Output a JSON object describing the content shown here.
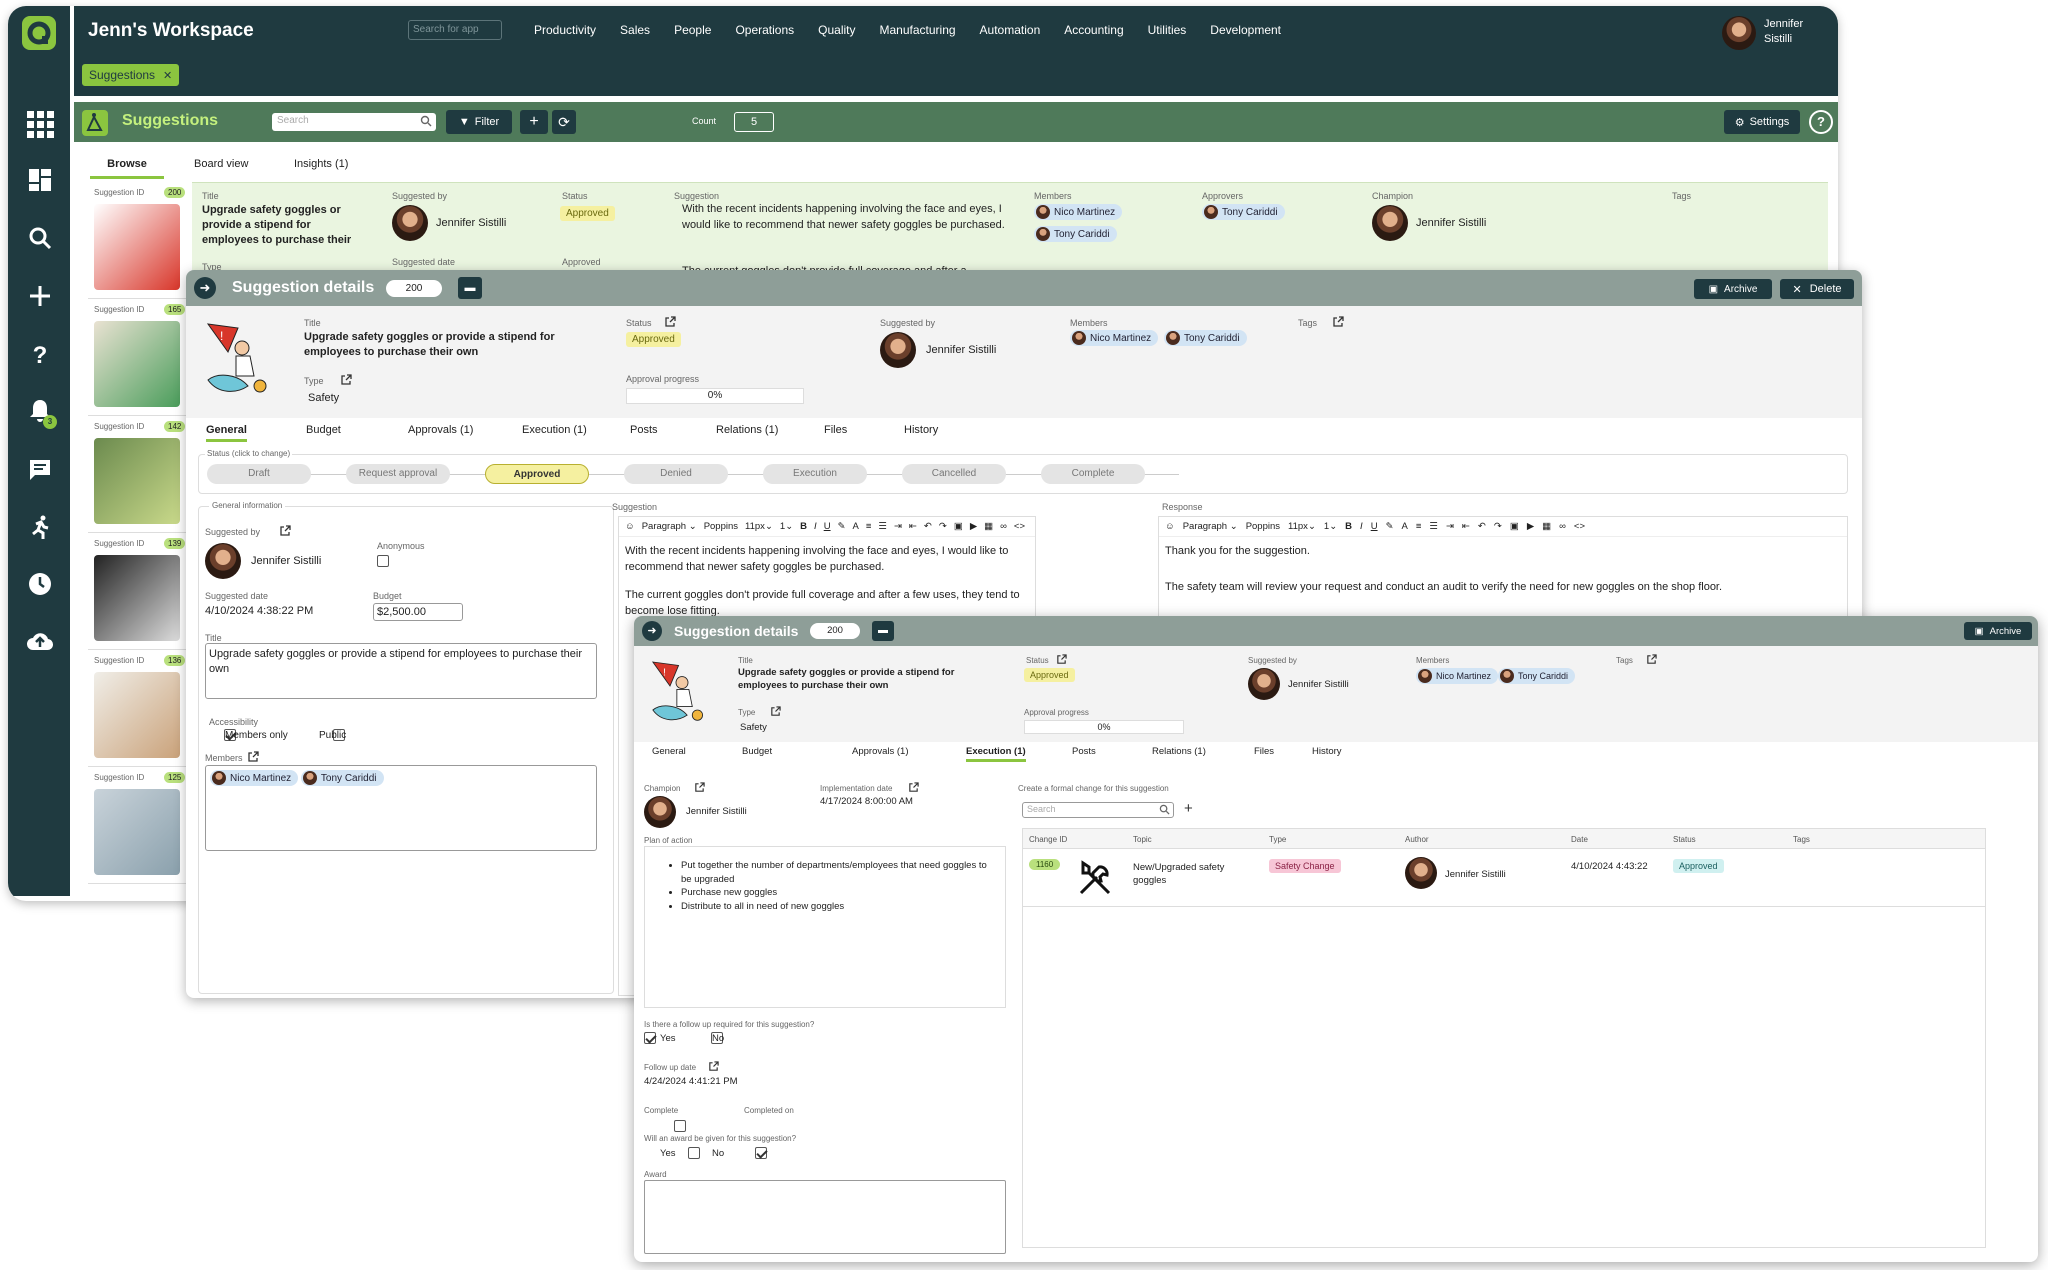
{
  "app": {
    "title": "Jenn's Workspace",
    "search_placeholder": "Search for app",
    "user_name": "Jennifer Sistilli",
    "user_name_l1": "Jennifer",
    "user_name_l2": "Sistilli",
    "notif_count": "3"
  },
  "nav": [
    "Productivity",
    "Sales",
    "People",
    "Operations",
    "Quality",
    "Manufacturing",
    "Automation",
    "Accounting",
    "Utilities",
    "Development"
  ],
  "tab_chip": "Suggestions",
  "toolbar": {
    "title": "Suggestions",
    "search_placeholder": "Search",
    "filter": "Filter",
    "count_label": "Count",
    "count": "5",
    "settings": "Settings"
  },
  "tabs": [
    "Browse",
    "Board view",
    "Insights (1)"
  ],
  "list": [
    {
      "id": "200"
    },
    {
      "id": "165"
    },
    {
      "id": "142"
    },
    {
      "id": "139"
    },
    {
      "id": "136"
    },
    {
      "id": "125"
    }
  ],
  "list_label": "Suggestion ID",
  "card": {
    "title_label": "Title",
    "title": "Upgrade safety goggles or provide a stipend for employees to purchase their",
    "type_label": "Type",
    "suggested_by_label": "Suggested by",
    "suggested_by": "Jennifer Sistilli",
    "suggested_date_label": "Suggested date",
    "status_label": "Status",
    "status": "Approved",
    "approved_label": "Approved",
    "suggestion_label": "Suggestion",
    "suggestion": "With the recent incidents happening involving the face and eyes, I would like to recommend that newer safety goggles be purchased.",
    "suggestion2": "The current goggles don't provide full coverage and after a",
    "members_label": "Members",
    "approvers_label": "Approvers",
    "approver": "Tony Cariddi",
    "champion_label": "Champion",
    "champion": "Jennifer Sistilli",
    "tags_label": "Tags",
    "members": [
      "Nico Martinez",
      "Tony Cariddi"
    ]
  },
  "details": {
    "header": "Suggestion details",
    "id": "200",
    "archive": "Archive",
    "delete": "Delete",
    "title_label": "Title",
    "title": "Upgrade safety goggles or provide a stipend for employees to purchase their own",
    "type_label": "Type",
    "type": "Safety",
    "status_label": "Status",
    "status": "Approved",
    "progress_label": "Approval progress",
    "progress": "0%",
    "suggested_by_label": "Suggested by",
    "suggested_by": "Jennifer Sistilli",
    "members_label": "Members",
    "members": [
      "Nico Martinez",
      "Tony Cariddi"
    ],
    "tags_label": "Tags",
    "tabs": [
      "General",
      "Budget",
      "Approvals (1)",
      "Execution (1)",
      "Posts",
      "Relations (1)",
      "Files",
      "History"
    ],
    "status_hint": "Status (click to change)",
    "steps": [
      "Draft",
      "Request approval",
      "Approved",
      "Denied",
      "Execution",
      "Cancelled",
      "Complete"
    ],
    "gen_info": "General information",
    "anonymous_label": "Anonymous",
    "suggested_date_label": "Suggested date",
    "suggested_date": "4/10/2024 4:38:22 PM",
    "budget_label": "Budget",
    "budget": "$2,500.00",
    "title_field": "Upgrade safety goggles or provide a stipend for employees to purchase their own",
    "accessibility_label": "Accessibility",
    "members_only": "Members only",
    "public": "Public",
    "suggestion_label": "Suggestion",
    "response_label": "Response",
    "editor": {
      "paragraph": "Paragraph",
      "font": "Poppins",
      "size": "11px",
      "lh": "1"
    },
    "suggestion_text": "With the recent incidents happening involving the face and eyes, I would like to recommend that newer safety goggles be purchased.",
    "suggestion_text2": "The current goggles don't provide full coverage and after a few uses, they tend to become lose fitting.",
    "response_text": "Thank you for the suggestion.",
    "response_text2": "The safety team will review your request and conduct an audit to verify the need for new goggles on the shop floor."
  },
  "exec": {
    "champion_label": "Champion",
    "champion": "Jennifer Sistilli",
    "impl_label": "Implementation date",
    "impl_date": "4/17/2024 8:00:00 AM",
    "plan_label": "Plan of action",
    "plan": [
      "Put together the number of departments/employees that need goggles to be upgraded",
      "Purchase new goggles",
      "Distribute to all in need of new goggles"
    ],
    "followup_q": "Is there a follow up required for this suggestion?",
    "yes": "Yes",
    "no": "No",
    "followup_date_label": "Follow up date",
    "followup_date": "4/24/2024 4:41:21 PM",
    "complete_label": "Complete",
    "completed_on_label": "Completed on",
    "award_q": "Will an award be given for this suggestion?",
    "award_label": "Award",
    "change_hint": "Create a formal change for this suggestion",
    "search_placeholder": "Search",
    "cols": [
      "Change ID",
      "Topic",
      "Type",
      "Author",
      "Date",
      "Status",
      "Tags"
    ],
    "row": {
      "id": "1160",
      "topic": "New/Upgraded safety goggles",
      "type": "Safety Change",
      "author": "Jennifer Sistilli",
      "date": "4/10/2024 4:43:22",
      "status": "Approved"
    }
  },
  "colors": {
    "dark": "#1f3a40",
    "accent": "#8bc53f",
    "approved": "#f5f0a0",
    "green_bg": "#eaf5e0"
  }
}
